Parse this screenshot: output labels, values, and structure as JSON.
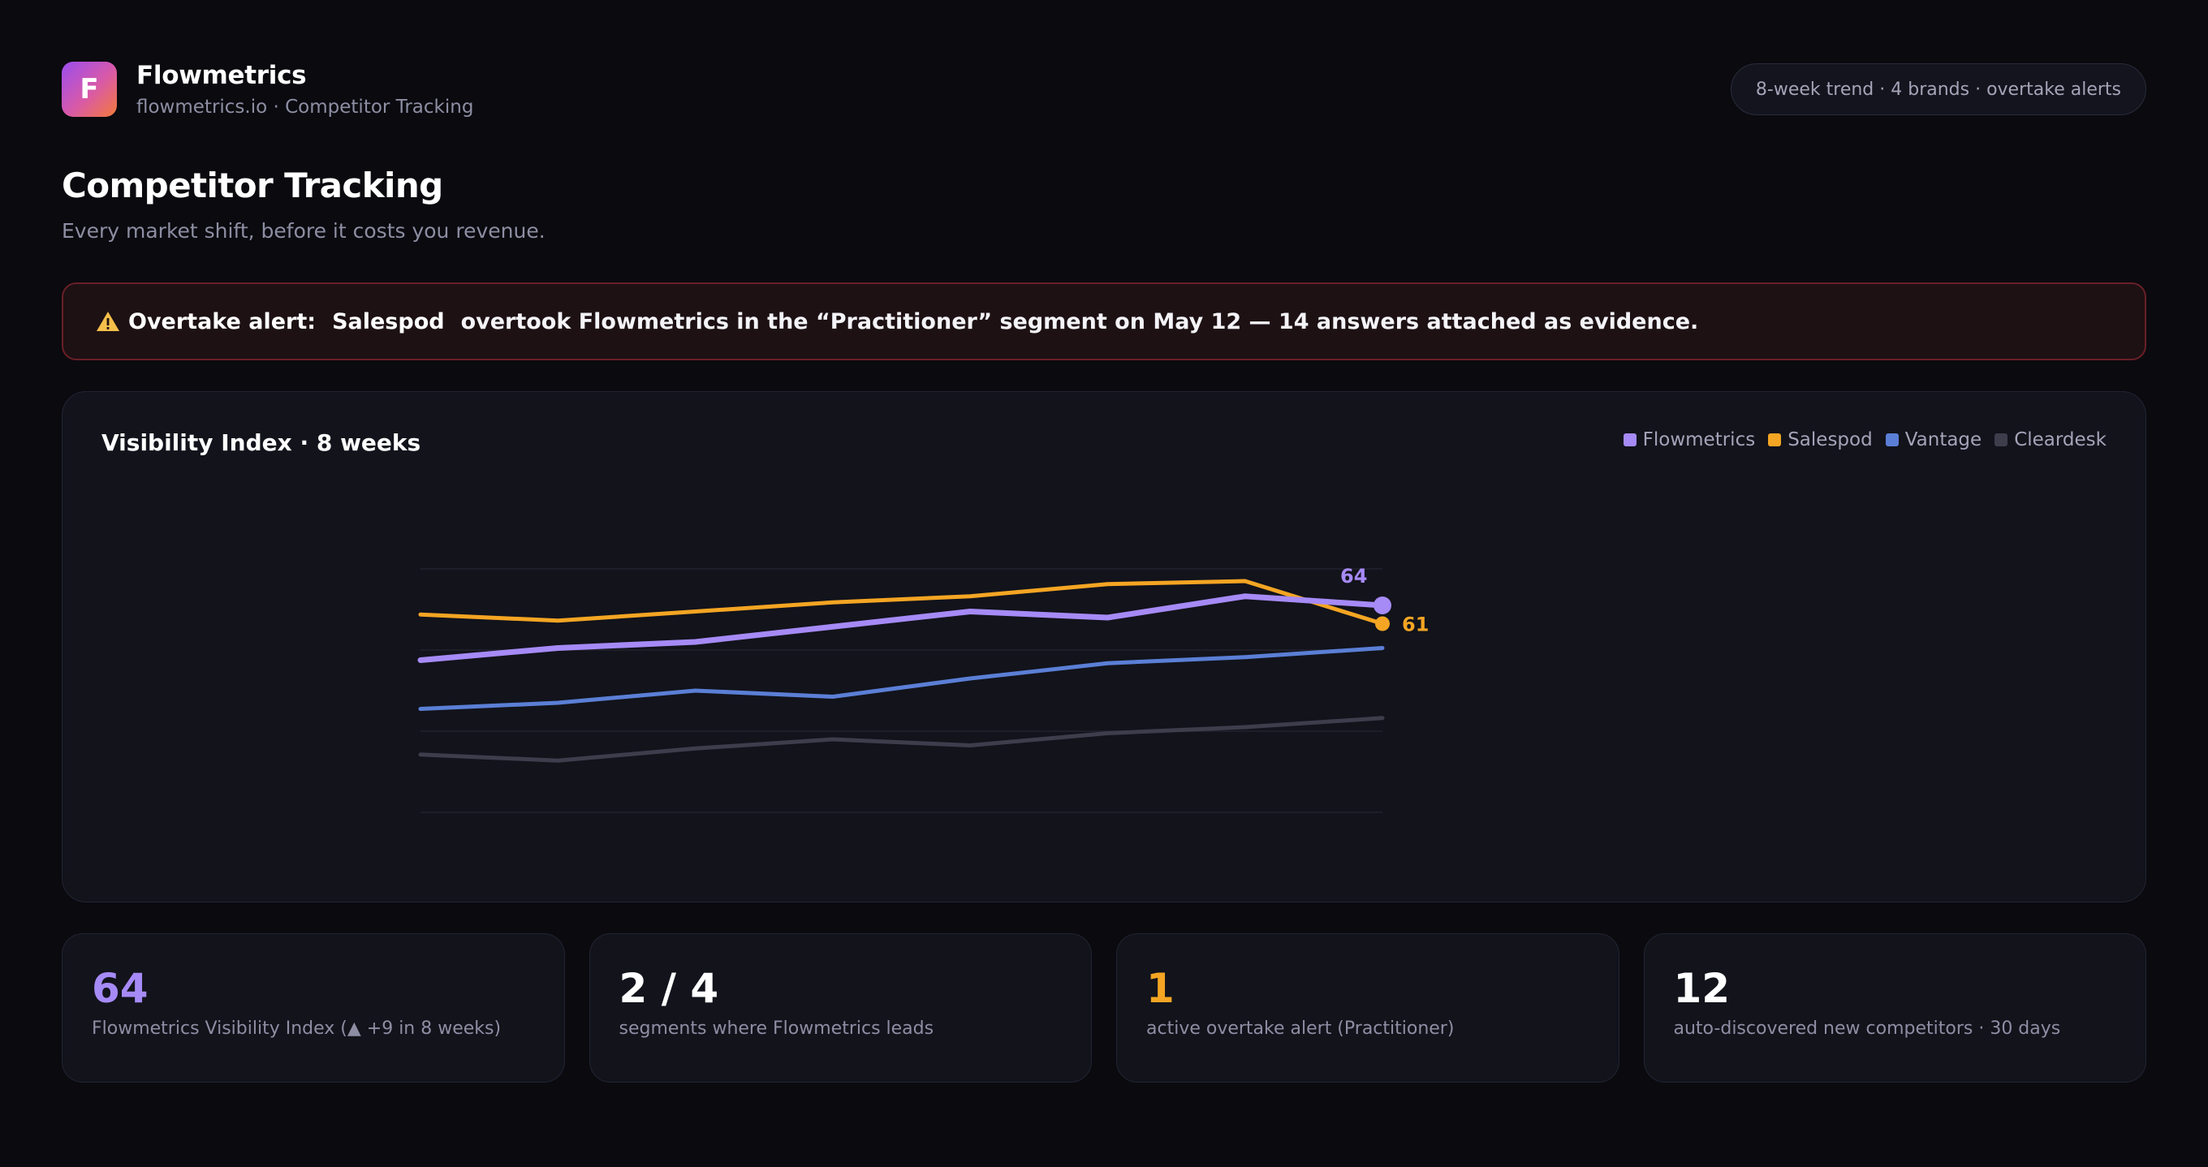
{
  "header": {
    "logo_letter": "F",
    "brand_name": "Flowmetrics",
    "brand_sub": "flowmetrics.io · Competitor Tracking",
    "pill_text": "8-week trend · 4 brands · overtake alerts"
  },
  "page": {
    "title": "Competitor Tracking",
    "subtitle": "Every market shift, before it costs you revenue."
  },
  "alert": {
    "icon": "warning-icon",
    "prefix": "Overtake alert:",
    "brand": "Salespod",
    "message": "overtook Flowmetrics in the “Practitioner” segment on May 12 — 14 answers attached as evidence.",
    "colors": {
      "border": "#6a1f26",
      "background": "#1d1114"
    }
  },
  "chart_data": {
    "type": "line",
    "title": "Visibility Index · 8 weeks",
    "xlabel": "",
    "ylabel": "",
    "x": [
      1,
      2,
      3,
      4,
      5,
      6,
      7,
      8
    ],
    "ylim": [
      30,
      70
    ],
    "grid": true,
    "legend_position": "top-right",
    "series": [
      {
        "name": "Flowmetrics",
        "color": "#a68af6",
        "values": [
          55,
          57,
          58,
          60.5,
          63,
          62,
          65.5,
          64
        ],
        "end_label": "64"
      },
      {
        "name": "Salespod",
        "color": "#f4a523",
        "values": [
          62.5,
          61.5,
          63,
          64.5,
          65.5,
          67.5,
          68,
          61
        ],
        "end_label": "61"
      },
      {
        "name": "Vantage",
        "color": "#5b7fd6",
        "values": [
          47,
          48,
          50,
          49,
          52,
          54.5,
          55.5,
          57
        ]
      },
      {
        "name": "Cleardesk",
        "color": "#3d3d4c",
        "values": [
          39.5,
          38.5,
          40.5,
          42,
          41,
          43,
          44,
          45.5
        ]
      }
    ]
  },
  "stats": [
    {
      "value": "64",
      "label": "Flowmetrics Visibility Index (▲ +9 in 8 weeks)",
      "color": "#a68af6"
    },
    {
      "value": "2 / 4",
      "label": "segments where Flowmetrics leads",
      "color": "#ffffff"
    },
    {
      "value": "1",
      "label": "active overtake alert (Practitioner)",
      "color": "#f4a523"
    },
    {
      "value": "12",
      "label": "auto-discovered new competitors · 30 days",
      "color": "#ffffff"
    }
  ]
}
